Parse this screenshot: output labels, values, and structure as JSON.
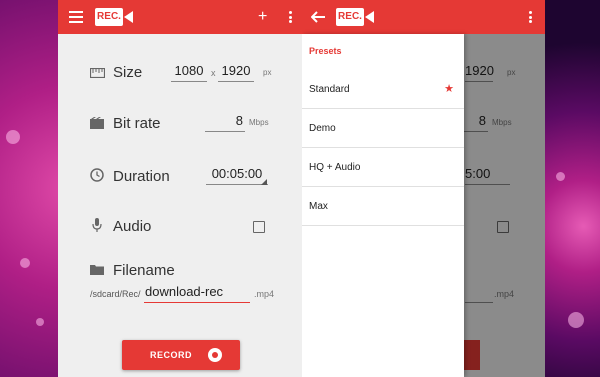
{
  "app": {
    "logo_text": "REC."
  },
  "settings": {
    "size": {
      "label": "Size",
      "width": "1080",
      "separator": "x",
      "height": "1920",
      "unit": "px"
    },
    "bitrate": {
      "label": "Bit rate",
      "value": "8",
      "unit": "Mbps"
    },
    "duration": {
      "label": "Duration",
      "value": "00:05:00"
    },
    "audio": {
      "label": "Audio",
      "checked": false
    },
    "filename": {
      "label": "Filename",
      "prefix": "/sdcard/Rec/",
      "value": "download-rec",
      "extension": ".mp4"
    }
  },
  "record_button": {
    "label": "RECORD"
  },
  "drawer": {
    "header": "Presets",
    "items": [
      {
        "label": "Standard",
        "starred": true
      },
      {
        "label": "Demo"
      },
      {
        "label": "HQ + Audio"
      },
      {
        "label": "Max"
      }
    ]
  },
  "background_partial": {
    "height_partial": "1920",
    "unit_px": "px",
    "bitrate_value": "8",
    "bitrate_unit": "Mbps",
    "duration_partial": "5:00",
    "extension": ".mp4"
  },
  "colors": {
    "accent": "#e53935",
    "surface": "#efefef",
    "drawer": "#ffffff"
  },
  "icons": [
    "hamburger-icon",
    "plus-icon",
    "overflow-menu-icon",
    "back-arrow-icon",
    "size-ruler-icon",
    "movie-icon",
    "clock-icon",
    "microphone-icon",
    "folder-icon",
    "star-icon",
    "record-dot-icon"
  ]
}
